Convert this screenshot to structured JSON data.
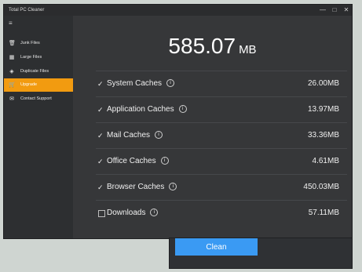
{
  "window": {
    "title": "Total PC Cleaner"
  },
  "sidebar": {
    "items": [
      {
        "label": "Junk Files"
      },
      {
        "label": "Large Files"
      },
      {
        "label": "Duplicate Files"
      },
      {
        "label": "Upgrade",
        "active": true
      },
      {
        "label": "Contact Support"
      }
    ]
  },
  "summary": {
    "total_value": "585.07",
    "total_unit": "MB"
  },
  "caches": [
    {
      "label": "System Caches",
      "size": "26.00MB",
      "checked": true
    },
    {
      "label": "Application Caches",
      "size": "13.97MB",
      "checked": true
    },
    {
      "label": "Mail Caches",
      "size": "33.36MB",
      "checked": true
    },
    {
      "label": "Office Caches",
      "size": "4.61MB",
      "checked": true
    },
    {
      "label": "Browser Caches",
      "size": "450.03MB",
      "checked": true
    },
    {
      "label": "Downloads",
      "size": "57.11MB",
      "checked": false
    }
  ],
  "actions": {
    "clean_label": "Clean"
  },
  "colors": {
    "accent": "#f29b10",
    "button": "#3a9af3",
    "background": "#363739"
  }
}
